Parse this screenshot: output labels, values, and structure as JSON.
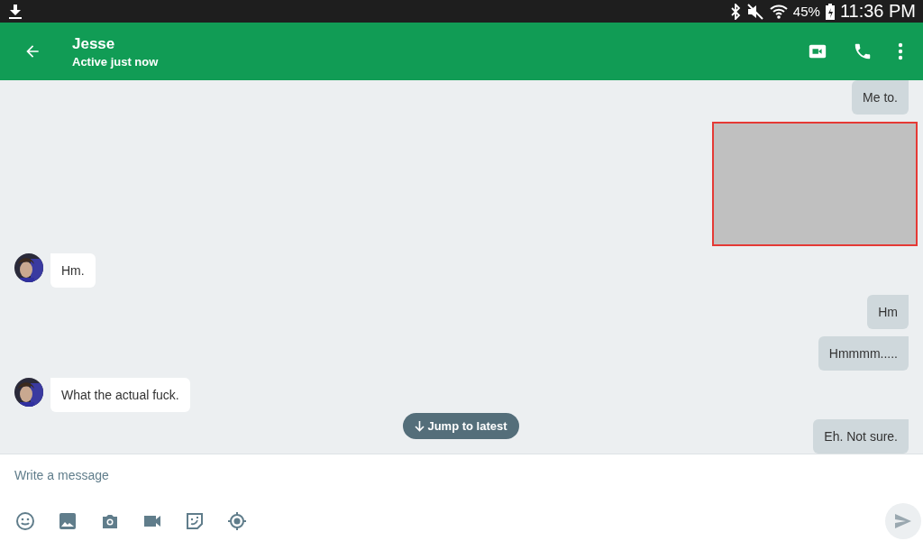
{
  "status_bar": {
    "battery": "45%",
    "time": "11:36 PM"
  },
  "header": {
    "title": "Jesse",
    "subtitle": "Active just now"
  },
  "messages": [
    {
      "kind": "text",
      "outgoing": true,
      "text": "Me to."
    },
    {
      "kind": "image",
      "outgoing": true
    },
    {
      "kind": "text",
      "outgoing": false,
      "text": "Hm."
    },
    {
      "kind": "text",
      "outgoing": true,
      "text": "Hm"
    },
    {
      "kind": "text",
      "outgoing": true,
      "text": "Hmmmm....."
    },
    {
      "kind": "text",
      "outgoing": false,
      "text": "What the actual fuck."
    },
    {
      "kind": "text",
      "outgoing": true,
      "text": "Eh. Not sure."
    }
  ],
  "jump_button": {
    "label": "Jump to latest"
  },
  "composer": {
    "placeholder": "Write a message"
  }
}
